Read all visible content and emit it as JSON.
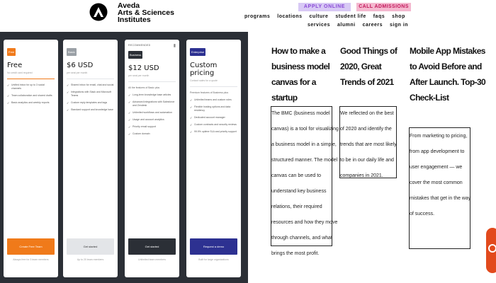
{
  "header": {
    "brand_line1": "Aveda",
    "brand_line2": "Arts & Sciences",
    "brand_line3": "Institutes",
    "apply_online": "APPLY ONLINE",
    "call_admissions": "CALL ADMISSIONS",
    "nav_row1": [
      "programs",
      "locations",
      "culture",
      "student life",
      "faqs",
      "shop"
    ],
    "nav_row2": [
      "services",
      "alumni",
      "careers",
      "sign in"
    ]
  },
  "pricing": {
    "plans": [
      {
        "tier": "Free",
        "price": "Free",
        "sub": "No credit card required",
        "features": [
          "Unified inbox for up to 3 social channels",
          "Team collaboration and shared drafts",
          "Basic analytics and weekly reports"
        ],
        "cta": "Create Free Team",
        "foot": "Always free for 3 team members",
        "color": "#f07a1a"
      },
      {
        "tier": "Basic",
        "price": "$6 USD",
        "sub": "per seat per month",
        "features": [
          "Shared inbox for email, chat and social",
          "Integrations with Slack and Microsoft Teams",
          "Custom reply templates and tags",
          "Standard support and knowledge base"
        ],
        "cta": "Get started",
        "foot": "Up to 20 team members",
        "color": "#e3e5e8"
      },
      {
        "tier": "Business",
        "top_label": "RECOMMENDED",
        "price": "$12 USD",
        "sub": "per seat per month",
        "features_intro": "All the features of Basic plus",
        "features": [
          "Long-term knowledge base articles",
          "Advanced integrations with Salesforce and Zendesk",
          "Unlimited workflows and automation",
          "Usage and account analytics",
          "Priority email support",
          "Custom domain"
        ],
        "cta": "Get started",
        "foot": "Unlimited team members",
        "color": "#2b2f36"
      },
      {
        "tier": "Enterprise",
        "price": "Custom pricing",
        "sub": "Contact sales for a quote",
        "features_intro": "Premium features of Business plus",
        "features": [
          "Unlimited teams and custom roles",
          "Flexible hosting options and data residency",
          "Dedicated account manager",
          "Custom contracts and security reviews",
          "99.9% uptime SLA and priority support"
        ],
        "cta": "Request a demo",
        "foot": "Built for large organizations",
        "color": "#2d3191"
      }
    ]
  },
  "blog": {
    "posts": [
      {
        "title": "How to make a business model canvas for a startup",
        "excerpt": "The BMC (business model canvas) is a tool for visualizing a business model in a simple, structured manner. The model canvas can be used to understand key business relations, their required resources and how they move through channels, and what brings the most profit."
      },
      {
        "title": "Good Things of 2020, Great Trends of 2021",
        "excerpt": "We reflected on the best of 2020 and identify the trends that are most likely to be in our daily life and companies in 2021."
      },
      {
        "title": "Mobile App Mistakes to Avoid Before and After Launch. Top-30 Check-List",
        "excerpt": "From marketing to pricing, from app development to user engagement — we cover the most common mistakes that get in the way of success."
      }
    ]
  },
  "chat": {
    "icon": "chat-icon",
    "color": "#e24a1d"
  }
}
